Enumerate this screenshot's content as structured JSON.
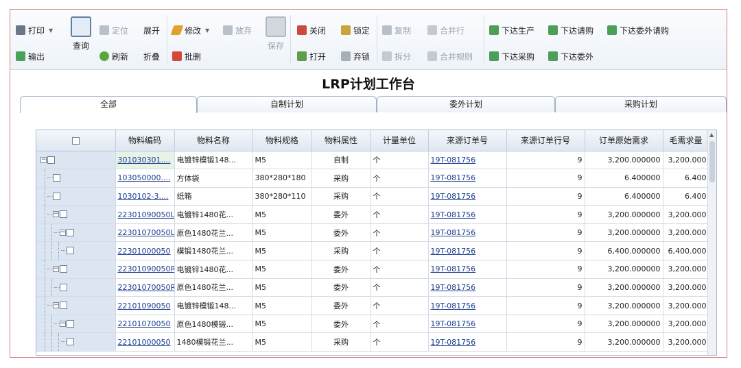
{
  "toolbar": {
    "print": "打印",
    "export": "输出",
    "query": "查询",
    "locate": "定位",
    "refresh": "刷新",
    "expand": "展开",
    "collapse": "折叠",
    "edit": "修改",
    "abandon": "放弃",
    "batch_delete": "批删",
    "save": "保存",
    "close": "关闭",
    "open": "打开",
    "lock": "锁定",
    "unlock": "弃锁",
    "copy": "复制",
    "split": "拆分",
    "merge_row": "合并行",
    "merge_rule": "合并规则",
    "issue_production": "下达生产",
    "issue_purchase_request": "下达请购",
    "issue_outsource_request": "下达委外请购",
    "issue_purchase": "下达采购",
    "issue_outsource": "下达委外"
  },
  "title": "LRP计划工作台",
  "tabs": [
    "全部",
    "自制计划",
    "委外计划",
    "采购计划"
  ],
  "table": {
    "headers": [
      "物料编码",
      "物料名称",
      "物料规格",
      "物料属性",
      "计量单位",
      "来源订单号",
      "来源订单行号",
      "订单原始需求",
      "毛需求量"
    ],
    "rows": [
      {
        "code": "301030301....",
        "name": "电镀锌模锻148...",
        "spec": "M5",
        "attr": "自制",
        "unit": "个",
        "order": "19T-081756",
        "line": "9",
        "orig": "3,200.000000",
        "gross": "3,200.000"
      },
      {
        "code": "103050000....",
        "name": "方体袋",
        "spec": "380*280*180",
        "attr": "采购",
        "unit": "个",
        "order": "19T-081756",
        "line": "9",
        "orig": "6.400000",
        "gross": "6.400"
      },
      {
        "code": "1030102-3....",
        "name": "纸箱",
        "spec": "380*280*110",
        "attr": "采购",
        "unit": "个",
        "order": "19T-081756",
        "line": "9",
        "orig": "6.400000",
        "gross": "6.400"
      },
      {
        "code": "22301090050L",
        "name": "电镀锌1480花...",
        "spec": "M5",
        "attr": "委外",
        "unit": "个",
        "order": "19T-081756",
        "line": "9",
        "orig": "3,200.000000",
        "gross": "3,200.000"
      },
      {
        "code": "22301070050L",
        "name": "原色1480花兰...",
        "spec": "M5",
        "attr": "委外",
        "unit": "个",
        "order": "19T-081756",
        "line": "9",
        "orig": "3,200.000000",
        "gross": "3,200.000"
      },
      {
        "code": "22301000050",
        "name": "模锻1480花兰...",
        "spec": "M5",
        "attr": "采购",
        "unit": "个",
        "order": "19T-081756",
        "line": "9",
        "orig": "6,400.000000",
        "gross": "6,400.000"
      },
      {
        "code": "22301090050R",
        "name": "电镀锌1480花...",
        "spec": "M5",
        "attr": "委外",
        "unit": "个",
        "order": "19T-081756",
        "line": "9",
        "orig": "3,200.000000",
        "gross": "3,200.000"
      },
      {
        "code": "22301070050R",
        "name": "原色1480花兰...",
        "spec": "M5",
        "attr": "委外",
        "unit": "个",
        "order": "19T-081756",
        "line": "9",
        "orig": "3,200.000000",
        "gross": "3,200.000"
      },
      {
        "code": "22101090050",
        "name": "电镀锌模锻148...",
        "spec": "M5",
        "attr": "委外",
        "unit": "个",
        "order": "19T-081756",
        "line": "9",
        "orig": "3,200.000000",
        "gross": "3,200.000"
      },
      {
        "code": "22101070050",
        "name": "原色1480模锻...",
        "spec": "M5",
        "attr": "委外",
        "unit": "个",
        "order": "19T-081756",
        "line": "9",
        "orig": "3,200.000000",
        "gross": "3,200.000"
      },
      {
        "code": "22101000050",
        "name": "1480模锻花兰...",
        "spec": "M5",
        "attr": "采购",
        "unit": "个",
        "order": "19T-081756",
        "line": "9",
        "orig": "3,200.000000",
        "gross": "3,200.000"
      }
    ]
  }
}
